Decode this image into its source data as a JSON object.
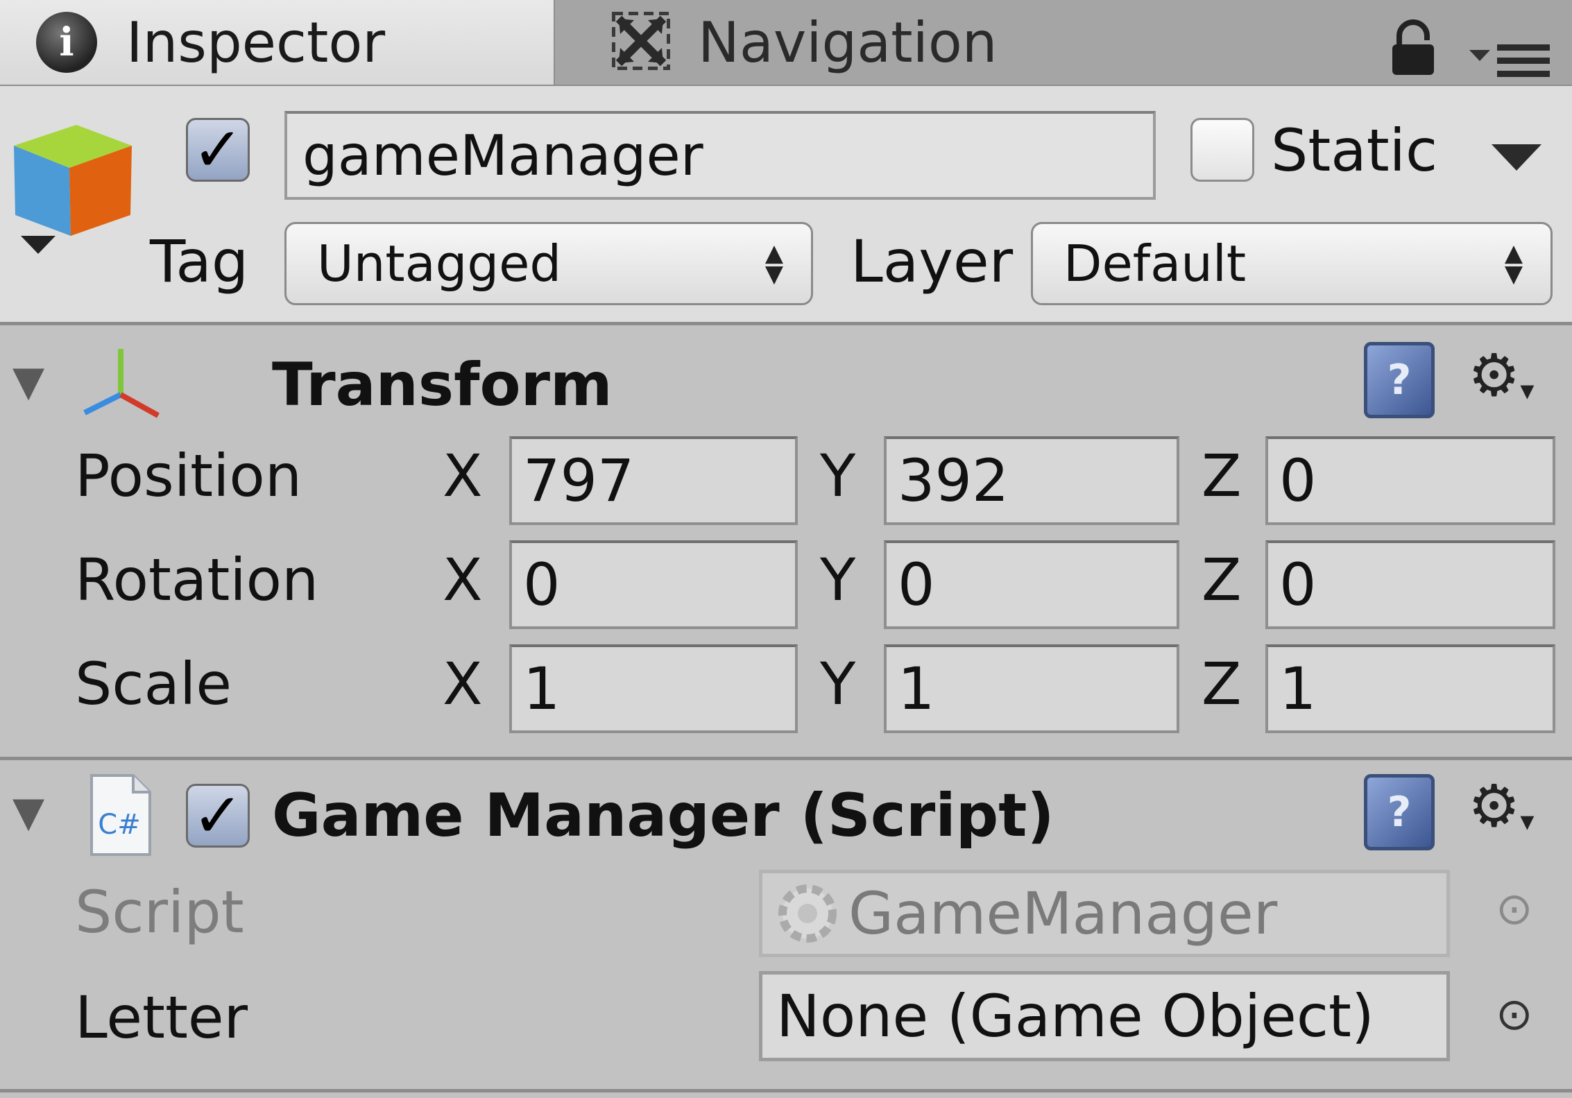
{
  "tabs": {
    "inspector": "Inspector",
    "navigation": "Navigation"
  },
  "header": {
    "name_value": "gameManager",
    "active_checked": true,
    "static_label": "Static",
    "static_checked": false,
    "tag_label": "Tag",
    "tag_value": "Untagged",
    "layer_label": "Layer",
    "layer_value": "Default"
  },
  "transform": {
    "title": "Transform",
    "rows": [
      {
        "label": "Position",
        "x": "797",
        "y": "392",
        "z": "0"
      },
      {
        "label": "Rotation",
        "x": "0",
        "y": "0",
        "z": "0"
      },
      {
        "label": "Scale",
        "x": "1",
        "y": "1",
        "z": "1"
      }
    ],
    "axes": {
      "x": "X",
      "y": "Y",
      "z": "Z"
    }
  },
  "script_component": {
    "title": "Game Manager (Script)",
    "enabled": true,
    "icon_text": "C#",
    "fields": {
      "script_label": "Script",
      "script_value": "GameManager",
      "letter_label": "Letter",
      "letter_value": "None (Game Object)"
    }
  },
  "icons": {
    "info": "info-icon",
    "navigation": "navigation-icon",
    "lock": "lock-icon",
    "menu": "menu-icon",
    "gameobject": "cube-icon",
    "transform": "axes-icon",
    "help": "help-book-icon",
    "gear": "gear-icon",
    "script": "csharp-file-icon",
    "object_picker": "object-picker-icon"
  },
  "colors": {
    "panel": "#c2c2c2",
    "header": "#dedede",
    "tab_active": "#e0e0e0",
    "tab_inactive": "#a5a5a5",
    "checkbox_on": "#93a4c4"
  }
}
